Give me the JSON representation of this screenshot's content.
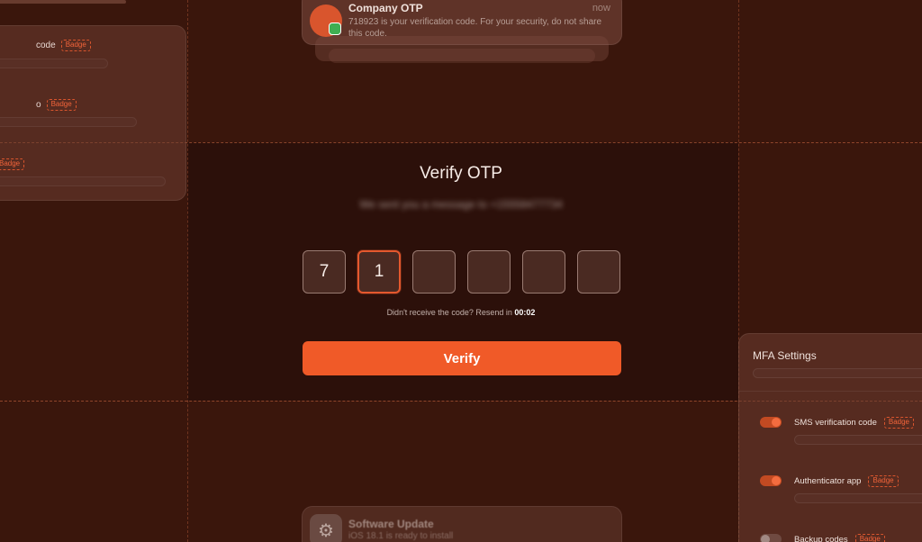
{
  "left_panel": {
    "rows": [
      {
        "label": "code",
        "badge": "Badge"
      },
      {
        "label": "o",
        "badge": "Badge"
      },
      {
        "label": "",
        "badge": "Badge"
      }
    ]
  },
  "notification": {
    "title": "Company OTP",
    "time": "now",
    "body": "718923 is your verification code. For your security, do not share this code.",
    "avatar_icon": "company-avatar-icon",
    "app_icon": "messages-icon"
  },
  "otp": {
    "title": "Verify OTP",
    "subtitle": "We sent you a message to +15558477734",
    "digits": [
      "7",
      "1",
      "",
      "",
      "",
      ""
    ],
    "active_index": 1,
    "resend_prefix": "Didn't receive the code? Resend in",
    "timer": "00:02",
    "verify_label": "Verify"
  },
  "mfa": {
    "title": "MFA Settings",
    "items": [
      {
        "label": "SMS verification code",
        "badge": "Badge",
        "enabled": true
      },
      {
        "label": "Authenticator app",
        "badge": "Badge",
        "enabled": true
      },
      {
        "label": "Backup codes",
        "badge": "Badge",
        "enabled": false
      }
    ]
  },
  "bottom_notification": {
    "title": "Software Update",
    "body": "iOS 18.1 is ready to install",
    "icon": "settings-gear-icon"
  },
  "colors": {
    "background": "#3a160c",
    "accent": "#f05a28",
    "badge": "#f2643a"
  }
}
